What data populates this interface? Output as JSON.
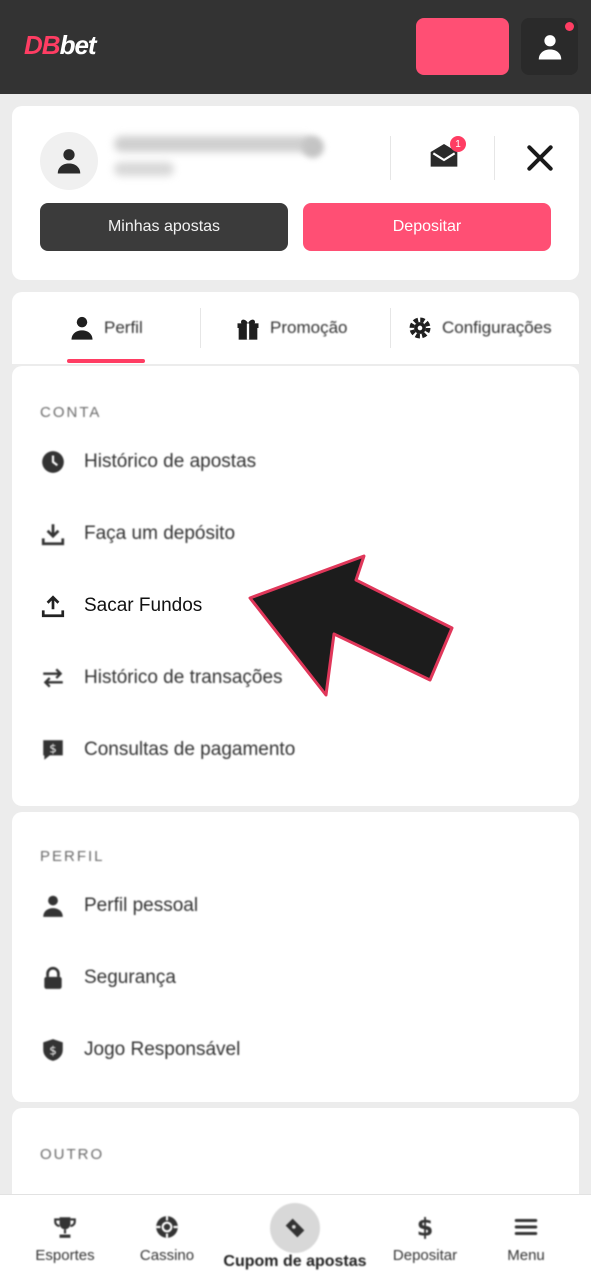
{
  "header": {
    "logo_db": "DB",
    "logo_bet": "bet",
    "notification_count": "1"
  },
  "account": {
    "my_bets_label": "Minhas apostas",
    "deposit_label": "Depositar"
  },
  "tabs": [
    {
      "label": "Perfil",
      "icon": "user-icon",
      "active": true
    },
    {
      "label": "Promoção",
      "icon": "gift-icon",
      "active": false
    },
    {
      "label": "Configurações",
      "icon": "gear-icon",
      "active": false
    }
  ],
  "sections": {
    "conta": {
      "title": "CONTA",
      "items": [
        {
          "label": "Histórico de apostas",
          "icon": "clock-icon"
        },
        {
          "label": "Faça um depósito",
          "icon": "download-icon"
        },
        {
          "label": "Sacar Fundos",
          "icon": "upload-icon"
        },
        {
          "label": "Histórico de transações",
          "icon": "transfer-icon"
        },
        {
          "label": "Consultas de pagamento",
          "icon": "dollar-chat-icon"
        }
      ]
    },
    "perfil": {
      "title": "PERFIL",
      "items": [
        {
          "label": "Perfil pessoal",
          "icon": "user-icon"
        },
        {
          "label": "Segurança",
          "icon": "lock-icon"
        },
        {
          "label": "Jogo Responsável",
          "icon": "shield-icon"
        }
      ]
    },
    "outro": {
      "title": "OUTRO"
    }
  },
  "bottom_nav": [
    {
      "label": "Esportes",
      "icon": "trophy-icon"
    },
    {
      "label": "Cassino",
      "icon": "casino-chip-icon"
    },
    {
      "label": "Cupom de apostas",
      "icon": "ticket-icon"
    },
    {
      "label": "Depositar",
      "icon": "dollar-icon"
    },
    {
      "label": "Menu",
      "icon": "hamburger-icon"
    }
  ],
  "colors": {
    "accent": "#ff3d63",
    "header_bg": "#333333",
    "page_bg": "#ececec"
  }
}
